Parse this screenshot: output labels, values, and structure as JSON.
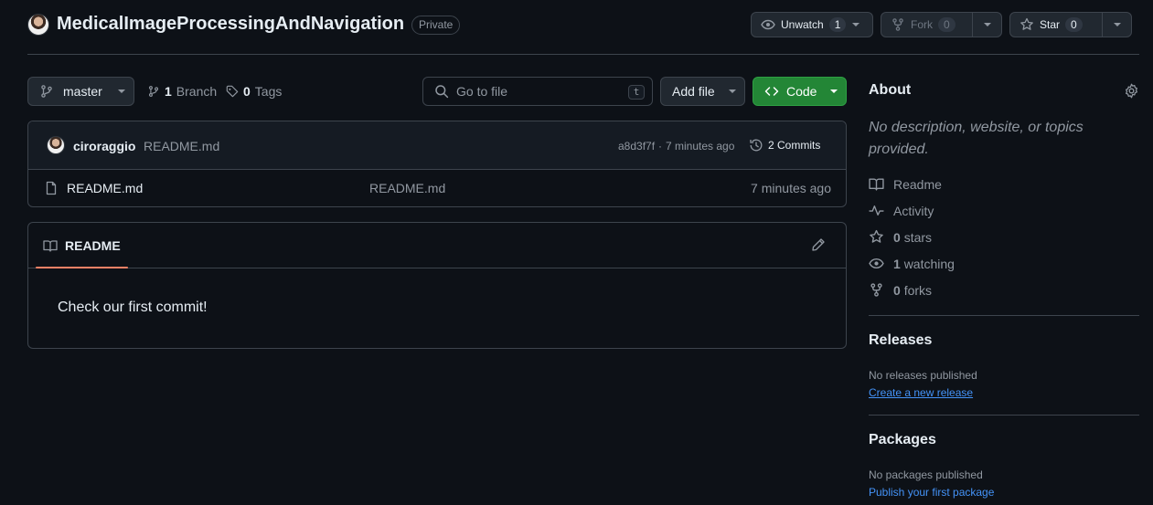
{
  "repo": {
    "name": "MedicalImageProcessingAndNavigation",
    "visibility": "Private",
    "unwatch_label": "Unwatch",
    "watch_count": "1",
    "fork_label": "Fork",
    "fork_count": "0",
    "star_label": "Star",
    "star_count": "0"
  },
  "toolbar": {
    "branch_name": "master",
    "branch_count": "1",
    "branch_label": "Branch",
    "tag_count": "0",
    "tag_label": "Tags",
    "search_placeholder": "Go to file",
    "search_shortcut": "t",
    "add_file_label": "Add file",
    "code_label": "Code"
  },
  "latest_commit": {
    "author": "ciroraggio",
    "message": "README.md",
    "hash": "a8d3f7f",
    "separator": "·",
    "time": "7 minutes ago",
    "commits_label": "2 Commits"
  },
  "files": [
    {
      "name": "README.md",
      "message": "README.md",
      "time": "7 minutes ago"
    }
  ],
  "readme": {
    "tab_label": "README",
    "content": "Check our first commit!"
  },
  "about": {
    "heading": "About",
    "description": "No description, website, or topics provided.",
    "items": [
      {
        "icon": "book-icon",
        "count": "",
        "label": "Readme"
      },
      {
        "icon": "pulse-icon",
        "count": "",
        "label": "Activity"
      },
      {
        "icon": "star-icon",
        "count": "0",
        "label": "stars"
      },
      {
        "icon": "eye-icon",
        "count": "1",
        "label": "watching"
      },
      {
        "icon": "fork-icon",
        "count": "0",
        "label": "forks"
      }
    ]
  },
  "releases": {
    "heading": "Releases",
    "empty_text": "No releases published",
    "create_link": "Create a new release"
  },
  "packages": {
    "heading": "Packages",
    "empty_text": "No packages published",
    "publish_link": "Publish your first package"
  },
  "colors": {
    "background": "#0d1117",
    "border": "#3d444d",
    "accent_green": "#238636",
    "link_blue": "#4493f8",
    "tab_underline": "#f78166"
  }
}
